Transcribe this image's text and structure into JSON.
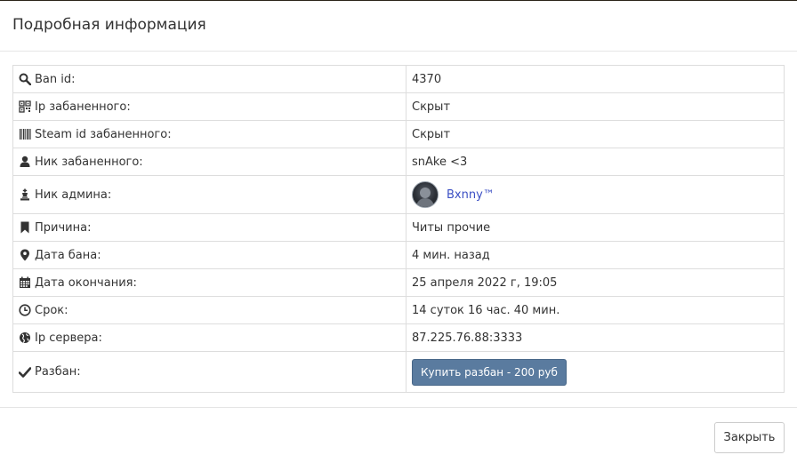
{
  "modal": {
    "title": "Подробная информация"
  },
  "rows": [
    {
      "icon": "search-icon",
      "label": "Ban id:",
      "value": "4370"
    },
    {
      "icon": "qrcode-icon",
      "label": "Ip забаненного:",
      "value": "Скрыт"
    },
    {
      "icon": "barcode-icon",
      "label": "Steam id забаненного:",
      "value": "Скрыт"
    },
    {
      "icon": "user-icon",
      "label": "Ник забаненного:",
      "value": "snAke <3"
    },
    {
      "icon": "chess-king-icon",
      "label": "Ник админа:",
      "value": "Bxnny™"
    },
    {
      "icon": "bookmark-icon",
      "label": "Причина:",
      "value": "Читы прочие"
    },
    {
      "icon": "map-marker-icon",
      "label": "Дата бана:",
      "value": "4 мин. назад"
    },
    {
      "icon": "calendar-icon",
      "label": "Дата окончания:",
      "value": "25 апреля 2022 г, 19:05"
    },
    {
      "icon": "clock-icon",
      "label": "Срок:",
      "value": "14 суток 16 час. 40 мин."
    },
    {
      "icon": "globe-icon",
      "label": "Ip сервера:",
      "value": "87.225.76.88:3333"
    },
    {
      "icon": "checkmark-icon",
      "label": "Разбан:",
      "value": "Купить разбан - 200 руб"
    }
  ],
  "footer": {
    "close_label": "Закрыть"
  },
  "colors": {
    "link": "#3b4fc4",
    "button": "#5a7b9f",
    "border": "#dddddd"
  }
}
